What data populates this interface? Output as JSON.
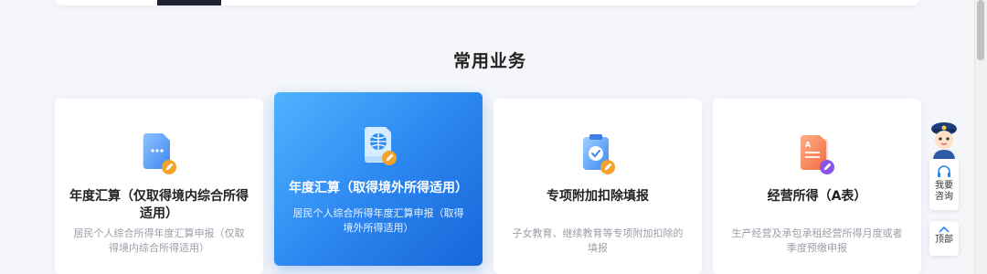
{
  "section": {
    "title": "常用业务"
  },
  "cards": [
    {
      "title": "年度汇算（仅取得境内综合所得适用）",
      "desc": "居民个人综合所得年度汇算申报（仅取得境内综合所得适用）",
      "icon": "document-chat-icon"
    },
    {
      "title": "年度汇算（取得境外所得适用）",
      "desc": "居民个人综合所得年度汇算申报（取得境外所得适用）",
      "icon": "globe-book-icon"
    },
    {
      "title": "专项附加扣除填报",
      "desc": "子女教育、继续教育等专项附加扣除的填报",
      "icon": "clipboard-check-icon"
    },
    {
      "title": "经营所得（A表）",
      "desc": "生产经营及承包承租经营所得月度或者季度预缴申报",
      "icon": "form-a-icon"
    }
  ],
  "float": {
    "consult": "我要\n咨询",
    "top": "顶部"
  },
  "colors": {
    "active_card": "#2a84ef",
    "pencil_badge": "#f4a12d",
    "form_badge": "#8a52e6"
  }
}
